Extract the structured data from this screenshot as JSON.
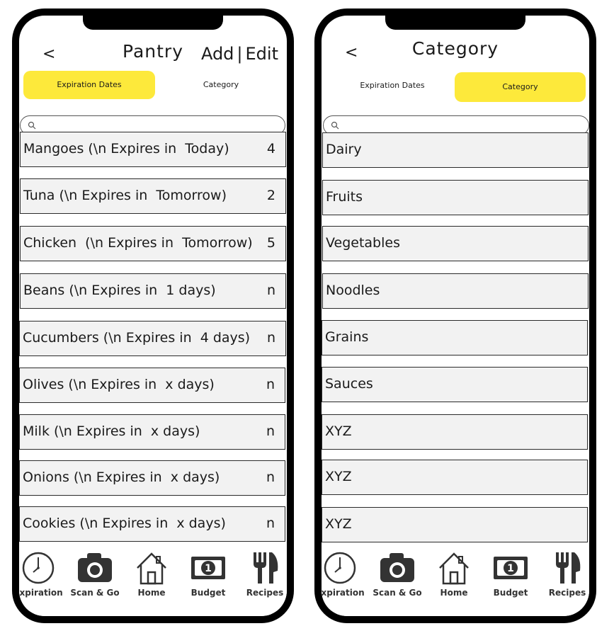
{
  "left": {
    "back": "<",
    "title": "Pantry",
    "add_label": "Add",
    "separator": "|",
    "edit_label": "Edit",
    "tabs": [
      {
        "label": "Expiration Dates",
        "active": true
      },
      {
        "label": "Category",
        "active": false
      }
    ],
    "search_placeholder": "",
    "items": [
      {
        "name": "Mangoes (\\n Expires in  Today)",
        "qty": "4"
      },
      {
        "name": "Tuna (\\n Expires in  Tomorrow)",
        "qty": "2"
      },
      {
        "name": "Chicken  (\\n Expires in  Tomorrow)",
        "qty": "5"
      },
      {
        "name": "Beans (\\n Expires in  1 days)",
        "qty": "n"
      },
      {
        "name": "Cucumbers (\\n Expires in  4 days)",
        "qty": "n"
      },
      {
        "name": "Olives (\\n Expires in  x days)",
        "qty": "n"
      },
      {
        "name": "Milk (\\n Expires in  x days)",
        "qty": "n"
      },
      {
        "name": "Onions (\\n Expires in  x days)",
        "qty": "n"
      },
      {
        "name": "Cookies (\\n Expires in  x days)",
        "qty": "n"
      }
    ]
  },
  "right": {
    "back": "<",
    "title": "Category",
    "tabs": [
      {
        "label": "Expiration Dates",
        "active": false
      },
      {
        "label": "Category",
        "active": true
      }
    ],
    "search_placeholder": "",
    "items": [
      {
        "name": "Dairy"
      },
      {
        "name": "Fruits"
      },
      {
        "name": "Vegetables"
      },
      {
        "name": "Noodles"
      },
      {
        "name": "Grains"
      },
      {
        "name": "Sauces"
      },
      {
        "name": "XYZ"
      },
      {
        "name": "XYZ"
      },
      {
        "name": "XYZ"
      }
    ]
  },
  "nav": [
    {
      "label": "Expiration",
      "icon": "clock-icon"
    },
    {
      "label": "Scan & Go",
      "icon": "camera-icon"
    },
    {
      "label": "Home",
      "icon": "home-icon"
    },
    {
      "label": "Budget",
      "icon": "banknote-icon"
    },
    {
      "label": "Recipes",
      "icon": "fork-knife-icon"
    }
  ],
  "colors": {
    "accent": "#fde93b",
    "row_bg": "#f2f2f2",
    "frame": "#000000"
  }
}
